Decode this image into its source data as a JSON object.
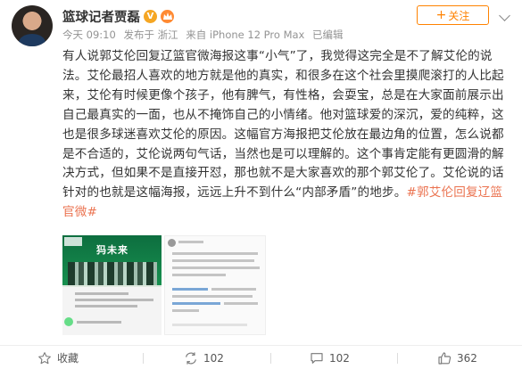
{
  "header": {
    "username": "篮球记者贾磊",
    "verified_badge": "V",
    "member_badge_icon": "vip-crown-icon",
    "meta": {
      "time": "今天 09:10",
      "source": "发布于 浙江",
      "device": "来自 iPhone 12 Pro Max",
      "status": "已编辑"
    },
    "follow_label": "关注",
    "follow_prefix": "+"
  },
  "post": {
    "text": "有人说郭艾伦回复辽篮官微海报这事“小气”了，我觉得这完全是不了解艾伦的说法。艾伦最招人喜欢的地方就是他的真实，和很多在这个社会里摸爬滚打的人比起来，艾伦有时候更像个孩子，他有脾气，有性格，会耍宝，总是在大家面前展示出自己最真实的一面，也从不掩饰自己的小情绪。他对篮球爱的深沉，爱的纯粹，这也是很多球迷喜欢艾伦的原因。这幅官方海报把艾伦放在最边角的位置，怎么说都是不合适的，艾伦说两句气话，当然也是可以理解的。这个事肯定能有更圆滑的解决方式，但如果不是直接开怼，那也就不是大家喜欢的那个郭艾伦了。艾伦说的话针对的也就是这幅海报，远远上升不到什么“内部矛盾”的地步。",
    "hashtag": "#郭艾伦回复辽篮官微#"
  },
  "images": [
    {
      "icon": "poster-thumbnail",
      "banner_text": "犸未来"
    },
    {
      "icon": "comment-screenshot-thumbnail"
    }
  ],
  "footer": {
    "favorite": {
      "icon": "star-icon",
      "label": "收藏"
    },
    "repost": {
      "icon": "repost-icon",
      "count": "102"
    },
    "comment": {
      "icon": "comment-icon",
      "count": "102"
    },
    "like": {
      "icon": "thumbs-up-icon",
      "count": "362"
    }
  },
  "colors": {
    "accent": "#ff8200",
    "hashtag": "#eb7350",
    "meta_gray": "#939393"
  }
}
